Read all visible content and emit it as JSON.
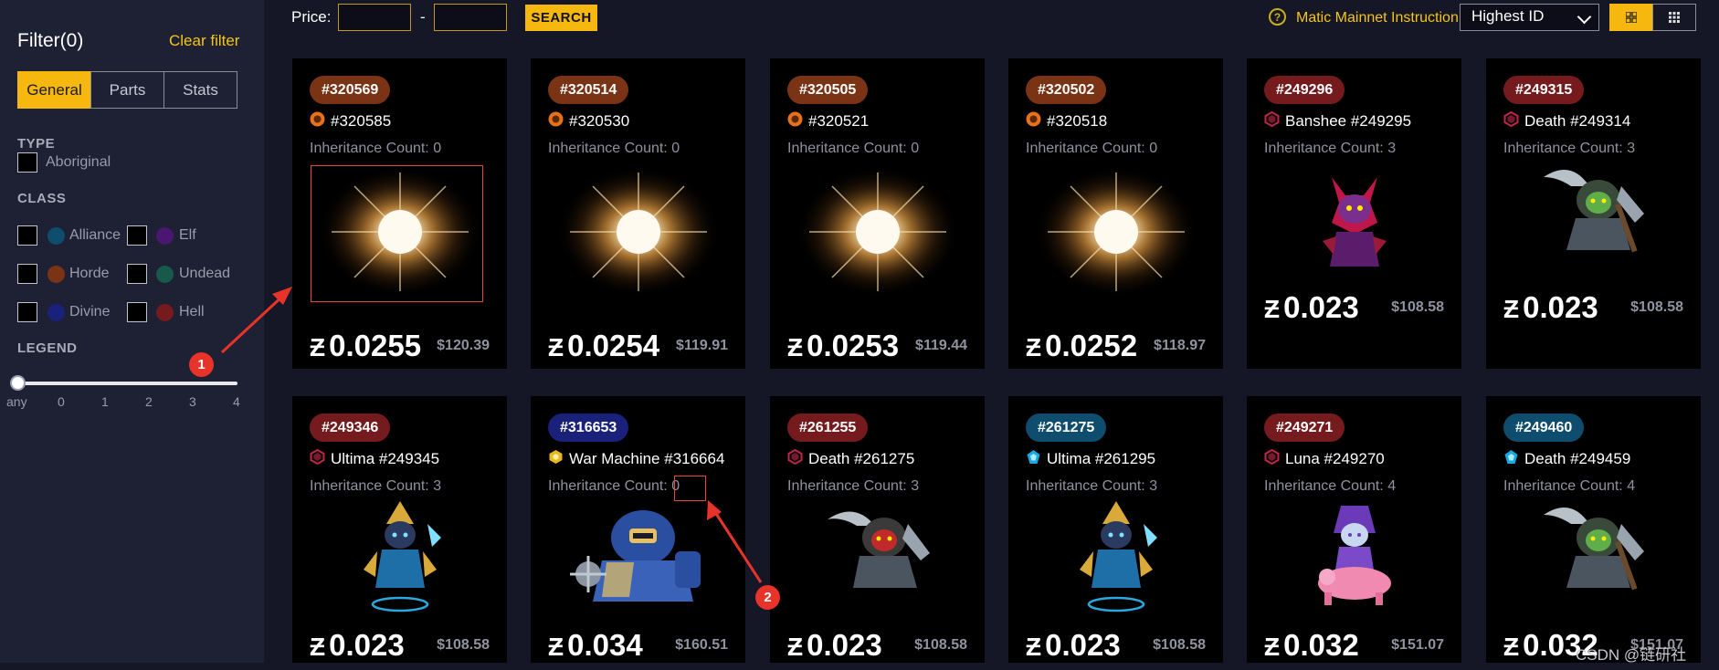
{
  "sidebar": {
    "filter_title": "Filter(0)",
    "clear_filter": "Clear filter",
    "tabs": [
      {
        "label": "General",
        "active": true
      },
      {
        "label": "Parts",
        "active": false
      },
      {
        "label": "Stats",
        "active": false
      }
    ],
    "type_label": "TYPE",
    "type_option": "Aboriginal",
    "class_label": "CLASS",
    "classes": [
      {
        "label": "Alliance",
        "color": "#0e4d6e"
      },
      {
        "label": "Elf",
        "color": "#4a1670"
      },
      {
        "label": "Horde",
        "color": "#7a3415"
      },
      {
        "label": "Undead",
        "color": "#175a49"
      },
      {
        "label": "Divine",
        "color": "#1a217a"
      },
      {
        "label": "Hell",
        "color": "#751b1e"
      }
    ],
    "legend_label": "LEGEND",
    "legend_ticks": [
      "any",
      "0",
      "1",
      "2",
      "3",
      "4"
    ],
    "legend_value": "any"
  },
  "topbar": {
    "price_label": "Price:",
    "price_min": "",
    "price_max": "",
    "dash": "-",
    "search_label": "SEARCH",
    "help_icon": "?",
    "matic_link": "Matic Mainnet Instruction",
    "sort_value": "Highest ID"
  },
  "cards": [
    {
      "badge": "#320569",
      "badge_color": "#7a3415",
      "icon": "horde",
      "name": "#320585",
      "inh_label": "Inheritance Count:",
      "inh_value": "0",
      "art": "egg",
      "price": "0.0255",
      "usd": "$120.39"
    },
    {
      "badge": "#320514",
      "badge_color": "#7a3415",
      "icon": "horde",
      "name": "#320530",
      "inh_label": "Inheritance Count:",
      "inh_value": "0",
      "art": "egg",
      "price": "0.0254",
      "usd": "$119.91"
    },
    {
      "badge": "#320505",
      "badge_color": "#7a3415",
      "icon": "horde",
      "name": "#320521",
      "inh_label": "Inheritance Count:",
      "inh_value": "0",
      "art": "egg",
      "price": "0.0253",
      "usd": "$119.44"
    },
    {
      "badge": "#320502",
      "badge_color": "#7a3415",
      "icon": "horde",
      "name": "#320518",
      "inh_label": "Inheritance Count:",
      "inh_value": "0",
      "art": "egg",
      "price": "0.0252",
      "usd": "$118.97"
    },
    {
      "badge": "#249296",
      "badge_color": "#751b1e",
      "icon": "hell",
      "name": "Banshee #249295",
      "inh_label": "Inheritance Count:",
      "inh_value": "3",
      "art": "banshee",
      "price": "0.023",
      "usd": "$108.58"
    },
    {
      "badge": "#249315",
      "badge_color": "#751b1e",
      "icon": "hell",
      "name": "Death #249314",
      "inh_label": "Inheritance Count:",
      "inh_value": "3",
      "art": "death",
      "price": "0.023",
      "usd": "$108.58"
    },
    {
      "badge": "#249346",
      "badge_color": "#751b1e",
      "icon": "hell",
      "name": "Ultima #249345",
      "inh_label": "Inheritance Count:",
      "inh_value": "3",
      "art": "ultima",
      "price": "0.023",
      "usd": "$108.58"
    },
    {
      "badge": "#316653",
      "badge_color": "#1a217a",
      "icon": "gold",
      "name": "War Machine #316664",
      "inh_label": "Inheritance Count:",
      "inh_value": "0",
      "art": "warmachine",
      "price": "0.034",
      "usd": "$160.51"
    },
    {
      "badge": "#261255",
      "badge_color": "#751b1e",
      "icon": "hell",
      "name": "Death #261275",
      "inh_label": "Inheritance Count:",
      "inh_value": "3",
      "art": "death2",
      "price": "0.023",
      "usd": "$108.58"
    },
    {
      "badge": "#261275",
      "badge_color": "#0e4d6e",
      "icon": "alliance",
      "name": "Ultima #261295",
      "inh_label": "Inheritance Count:",
      "inh_value": "3",
      "art": "ultima",
      "price": "0.023",
      "usd": "$108.58"
    },
    {
      "badge": "#249271",
      "badge_color": "#751b1e",
      "icon": "hell",
      "name": "Luna #249270",
      "inh_label": "Inheritance Count:",
      "inh_value": "4",
      "art": "luna",
      "price": "0.032",
      "usd": "$151.07"
    },
    {
      "badge": "#249460",
      "badge_color": "#0e4d6e",
      "icon": "alliance",
      "name": "Death #249459",
      "inh_label": "Inheritance Count:",
      "inh_value": "4",
      "art": "death",
      "price": "0.032",
      "usd": "$151.07"
    }
  ],
  "annotations": {
    "marker_1": "1",
    "marker_2": "2"
  },
  "watermark": "CSDN @链研社",
  "currency_symbol": "Ƶ",
  "colors": {
    "accent": "#f6b70f",
    "annotation": "#e8332a"
  }
}
